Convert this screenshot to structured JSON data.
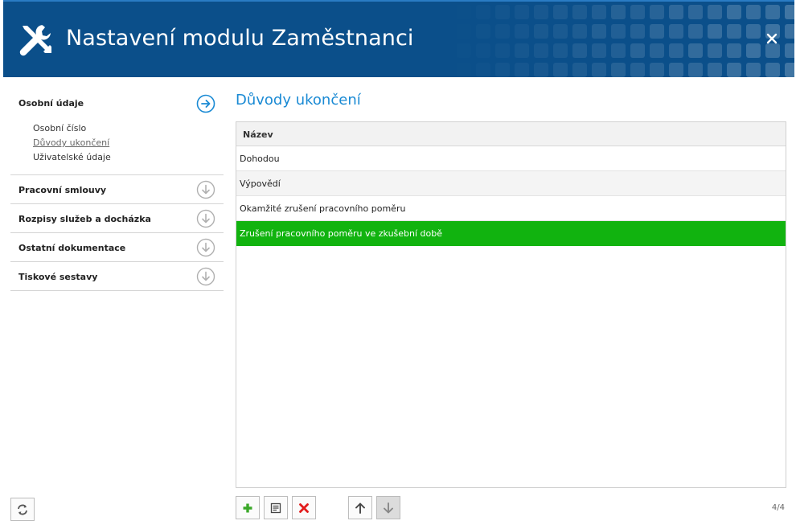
{
  "header": {
    "title": "Nastavení modulu Zaměstnanci",
    "icon": "tools-icon",
    "bg_color": "#0b4f8a"
  },
  "sidebar": {
    "sections": [
      {
        "title": "Osobní údaje",
        "expanded": true,
        "items": [
          "Osobní číslo",
          "Důvody ukončení",
          "Uživatelské údaje"
        ]
      },
      {
        "title": "Pracovní smlouvy",
        "expanded": false
      },
      {
        "title": "Rozpisy služeb a docházka",
        "expanded": false
      },
      {
        "title": "Ostatní dokumentace",
        "expanded": false
      },
      {
        "title": "Tiskové sestavy",
        "expanded": false
      }
    ]
  },
  "main": {
    "title": "Důvody ukončení",
    "grid": {
      "column_header": "Název",
      "rows": [
        "Dohodou",
        "Výpovědí",
        "Okamžité zrušení pracovního poměru",
        "Zrušení pracovního poměru ve zkušební době"
      ],
      "selected_row": 3,
      "selected_color": "#11b30f"
    },
    "counter": "4/4"
  },
  "colors": {
    "accent": "#1a8ad4",
    "add_icon": "#3aa828",
    "delete_icon": "#e21b1b"
  }
}
